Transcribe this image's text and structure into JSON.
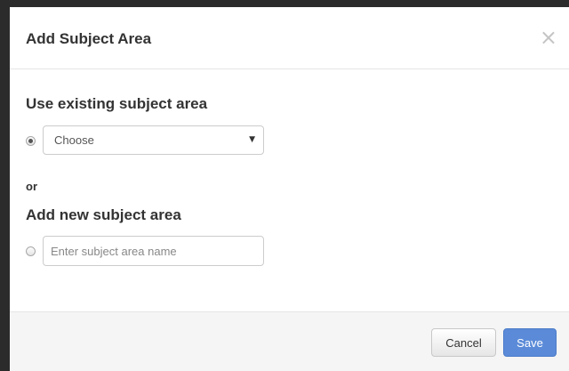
{
  "dialog": {
    "title": "Add Subject Area",
    "close_glyph": "×"
  },
  "existing": {
    "heading": "Use existing subject area",
    "radio_selected": true,
    "select_value": "Choose",
    "caret_glyph": "▼"
  },
  "separator": "or",
  "new_area": {
    "heading": "Add new subject area",
    "radio_selected": false,
    "input_value": "",
    "input_placeholder": "Enter subject area name"
  },
  "footer": {
    "cancel_label": "Cancel",
    "save_label": "Save"
  },
  "colors": {
    "primary_button": "#5b8bd8",
    "footer_background": "#f5f5f5",
    "overlay": "#2b2b2b"
  },
  "icons": {
    "close": "close-icon",
    "dropdown": "chevron-down-icon"
  }
}
